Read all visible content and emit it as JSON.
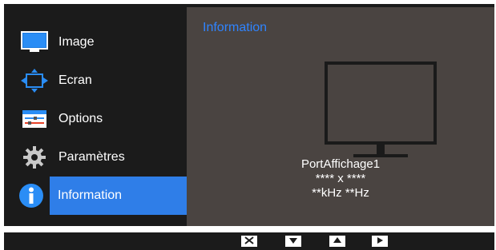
{
  "sidebar": {
    "items": [
      {
        "label": "Image",
        "icon": "monitor-icon"
      },
      {
        "label": "Ecran",
        "icon": "screen-resize-icon"
      },
      {
        "label": "Options",
        "icon": "options-icon"
      },
      {
        "label": "Paramètres",
        "icon": "gear-icon"
      },
      {
        "label": "Information",
        "icon": "info-icon"
      }
    ]
  },
  "panel": {
    "title": "Information",
    "source_name": "PortAffichage1",
    "resolution": "**** x ****",
    "frequency": "**kHz **Hz"
  },
  "controls": [
    {
      "icon": "close-icon"
    },
    {
      "icon": "arrow-down-icon"
    },
    {
      "icon": "arrow-up-icon"
    },
    {
      "icon": "arrow-right-icon"
    }
  ],
  "colors": {
    "accent": "#2f7ee8",
    "panel_bg": "#4a4441",
    "menu_bg": "#1b1b1b",
    "title": "#2f84ff"
  }
}
